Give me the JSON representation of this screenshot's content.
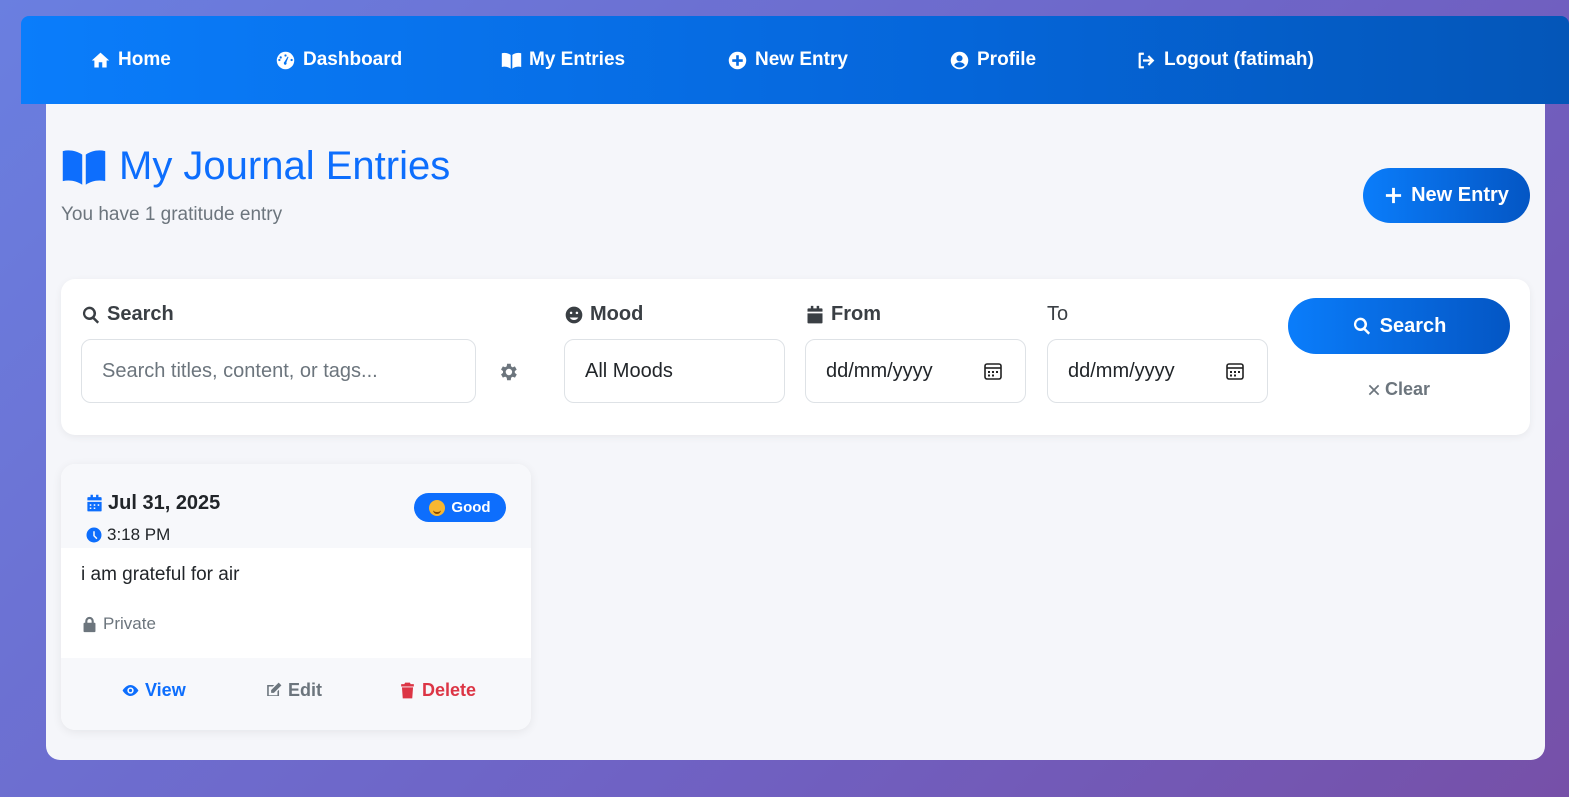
{
  "nav": {
    "items": [
      {
        "label": "Home",
        "icon": "home-icon"
      },
      {
        "label": "Dashboard",
        "icon": "tachometer-icon"
      },
      {
        "label": "My Entries",
        "icon": "book-open-icon"
      },
      {
        "label": "New Entry",
        "icon": "plus-circle-icon"
      },
      {
        "label": "Profile",
        "icon": "user-circle-icon"
      },
      {
        "label": "Logout (fatimah)",
        "icon": "sign-out-icon"
      }
    ]
  },
  "header": {
    "title": "My Journal Entries",
    "subtitle": "You have 1 gratitude entry",
    "new_entry_label": "New Entry"
  },
  "filters": {
    "search_label": "Search",
    "search_placeholder": "Search titles, content, or tags...",
    "mood_label": "Mood",
    "mood_value": "All Moods",
    "from_label": "From",
    "from_placeholder": "dd/mm/yyyy",
    "to_label": "To",
    "to_placeholder": "dd/mm/yyyy",
    "search_button": "Search",
    "clear_label": "Clear"
  },
  "entries": [
    {
      "date": "Jul 31, 2025",
      "time": "3:18 PM",
      "mood": "Good",
      "text": "i am grateful for air",
      "privacy": "Private",
      "actions": {
        "view": "View",
        "edit": "Edit",
        "delete": "Delete"
      }
    }
  ],
  "colors": {
    "primary": "#0d6efd",
    "danger": "#dc3545",
    "muted": "#6c757d"
  }
}
